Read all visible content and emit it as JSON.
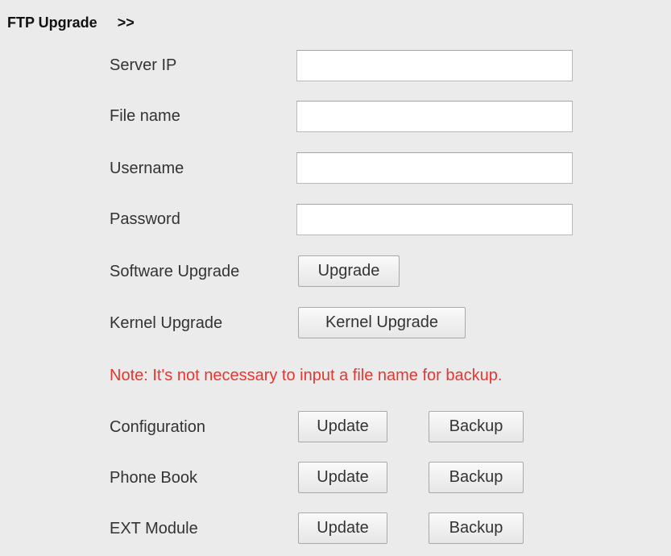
{
  "header": {
    "title": "FTP Upgrade",
    "arrows": ">>"
  },
  "fields": {
    "server_ip": {
      "label": "Server IP",
      "value": ""
    },
    "file_name": {
      "label": "File name",
      "value": ""
    },
    "username": {
      "label": "Username",
      "value": ""
    },
    "password": {
      "label": "Password",
      "value": ""
    }
  },
  "software": {
    "label": "Software Upgrade",
    "button": "Upgrade"
  },
  "kernel": {
    "label": "Kernel Upgrade",
    "button": "Kernel Upgrade"
  },
  "note": "Note: It's not necessary to input a file name for backup.",
  "configuration": {
    "label": "Configuration",
    "update": "Update",
    "backup": "Backup"
  },
  "phone_book": {
    "label": "Phone Book",
    "update": "Update",
    "backup": "Backup"
  },
  "ext_module": {
    "label": "EXT Module",
    "update": "Update",
    "backup": "Backup"
  },
  "colors": {
    "background": "#ebebeb",
    "note": "#e8352f"
  }
}
